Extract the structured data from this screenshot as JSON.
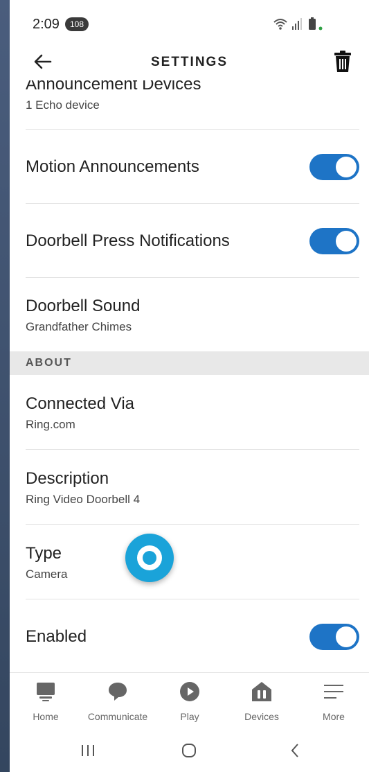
{
  "status_bar": {
    "time": "2:09",
    "notification_count": "108"
  },
  "header": {
    "title": "SETTINGS"
  },
  "settings": {
    "announcement_devices": {
      "title": "Announcement Devices",
      "subtitle": "1 Echo device"
    },
    "motion_announcements": {
      "title": "Motion Announcements",
      "enabled": true
    },
    "doorbell_press": {
      "title": "Doorbell Press Notifications",
      "enabled": true
    },
    "doorbell_sound": {
      "title": "Doorbell Sound",
      "subtitle": "Grandfather Chimes"
    }
  },
  "about": {
    "section_label": "ABOUT",
    "connected_via": {
      "title": "Connected Via",
      "subtitle": "Ring.com"
    },
    "description": {
      "title": "Description",
      "subtitle": "Ring Video Doorbell 4"
    },
    "type": {
      "title": "Type",
      "subtitle": "Camera"
    },
    "enabled": {
      "title": "Enabled",
      "enabled": true
    }
  },
  "bottom_nav": {
    "items": [
      {
        "label": "Home",
        "icon": "home-icon"
      },
      {
        "label": "Communicate",
        "icon": "chat-bubble-icon"
      },
      {
        "label": "Play",
        "icon": "play-icon"
      },
      {
        "label": "Devices",
        "icon": "devices-icon"
      },
      {
        "label": "More",
        "icon": "hamburger-menu-icon"
      }
    ]
  },
  "colors": {
    "toggle_on": "#1e74c6",
    "alexa_blue": "#1aa3d9"
  }
}
